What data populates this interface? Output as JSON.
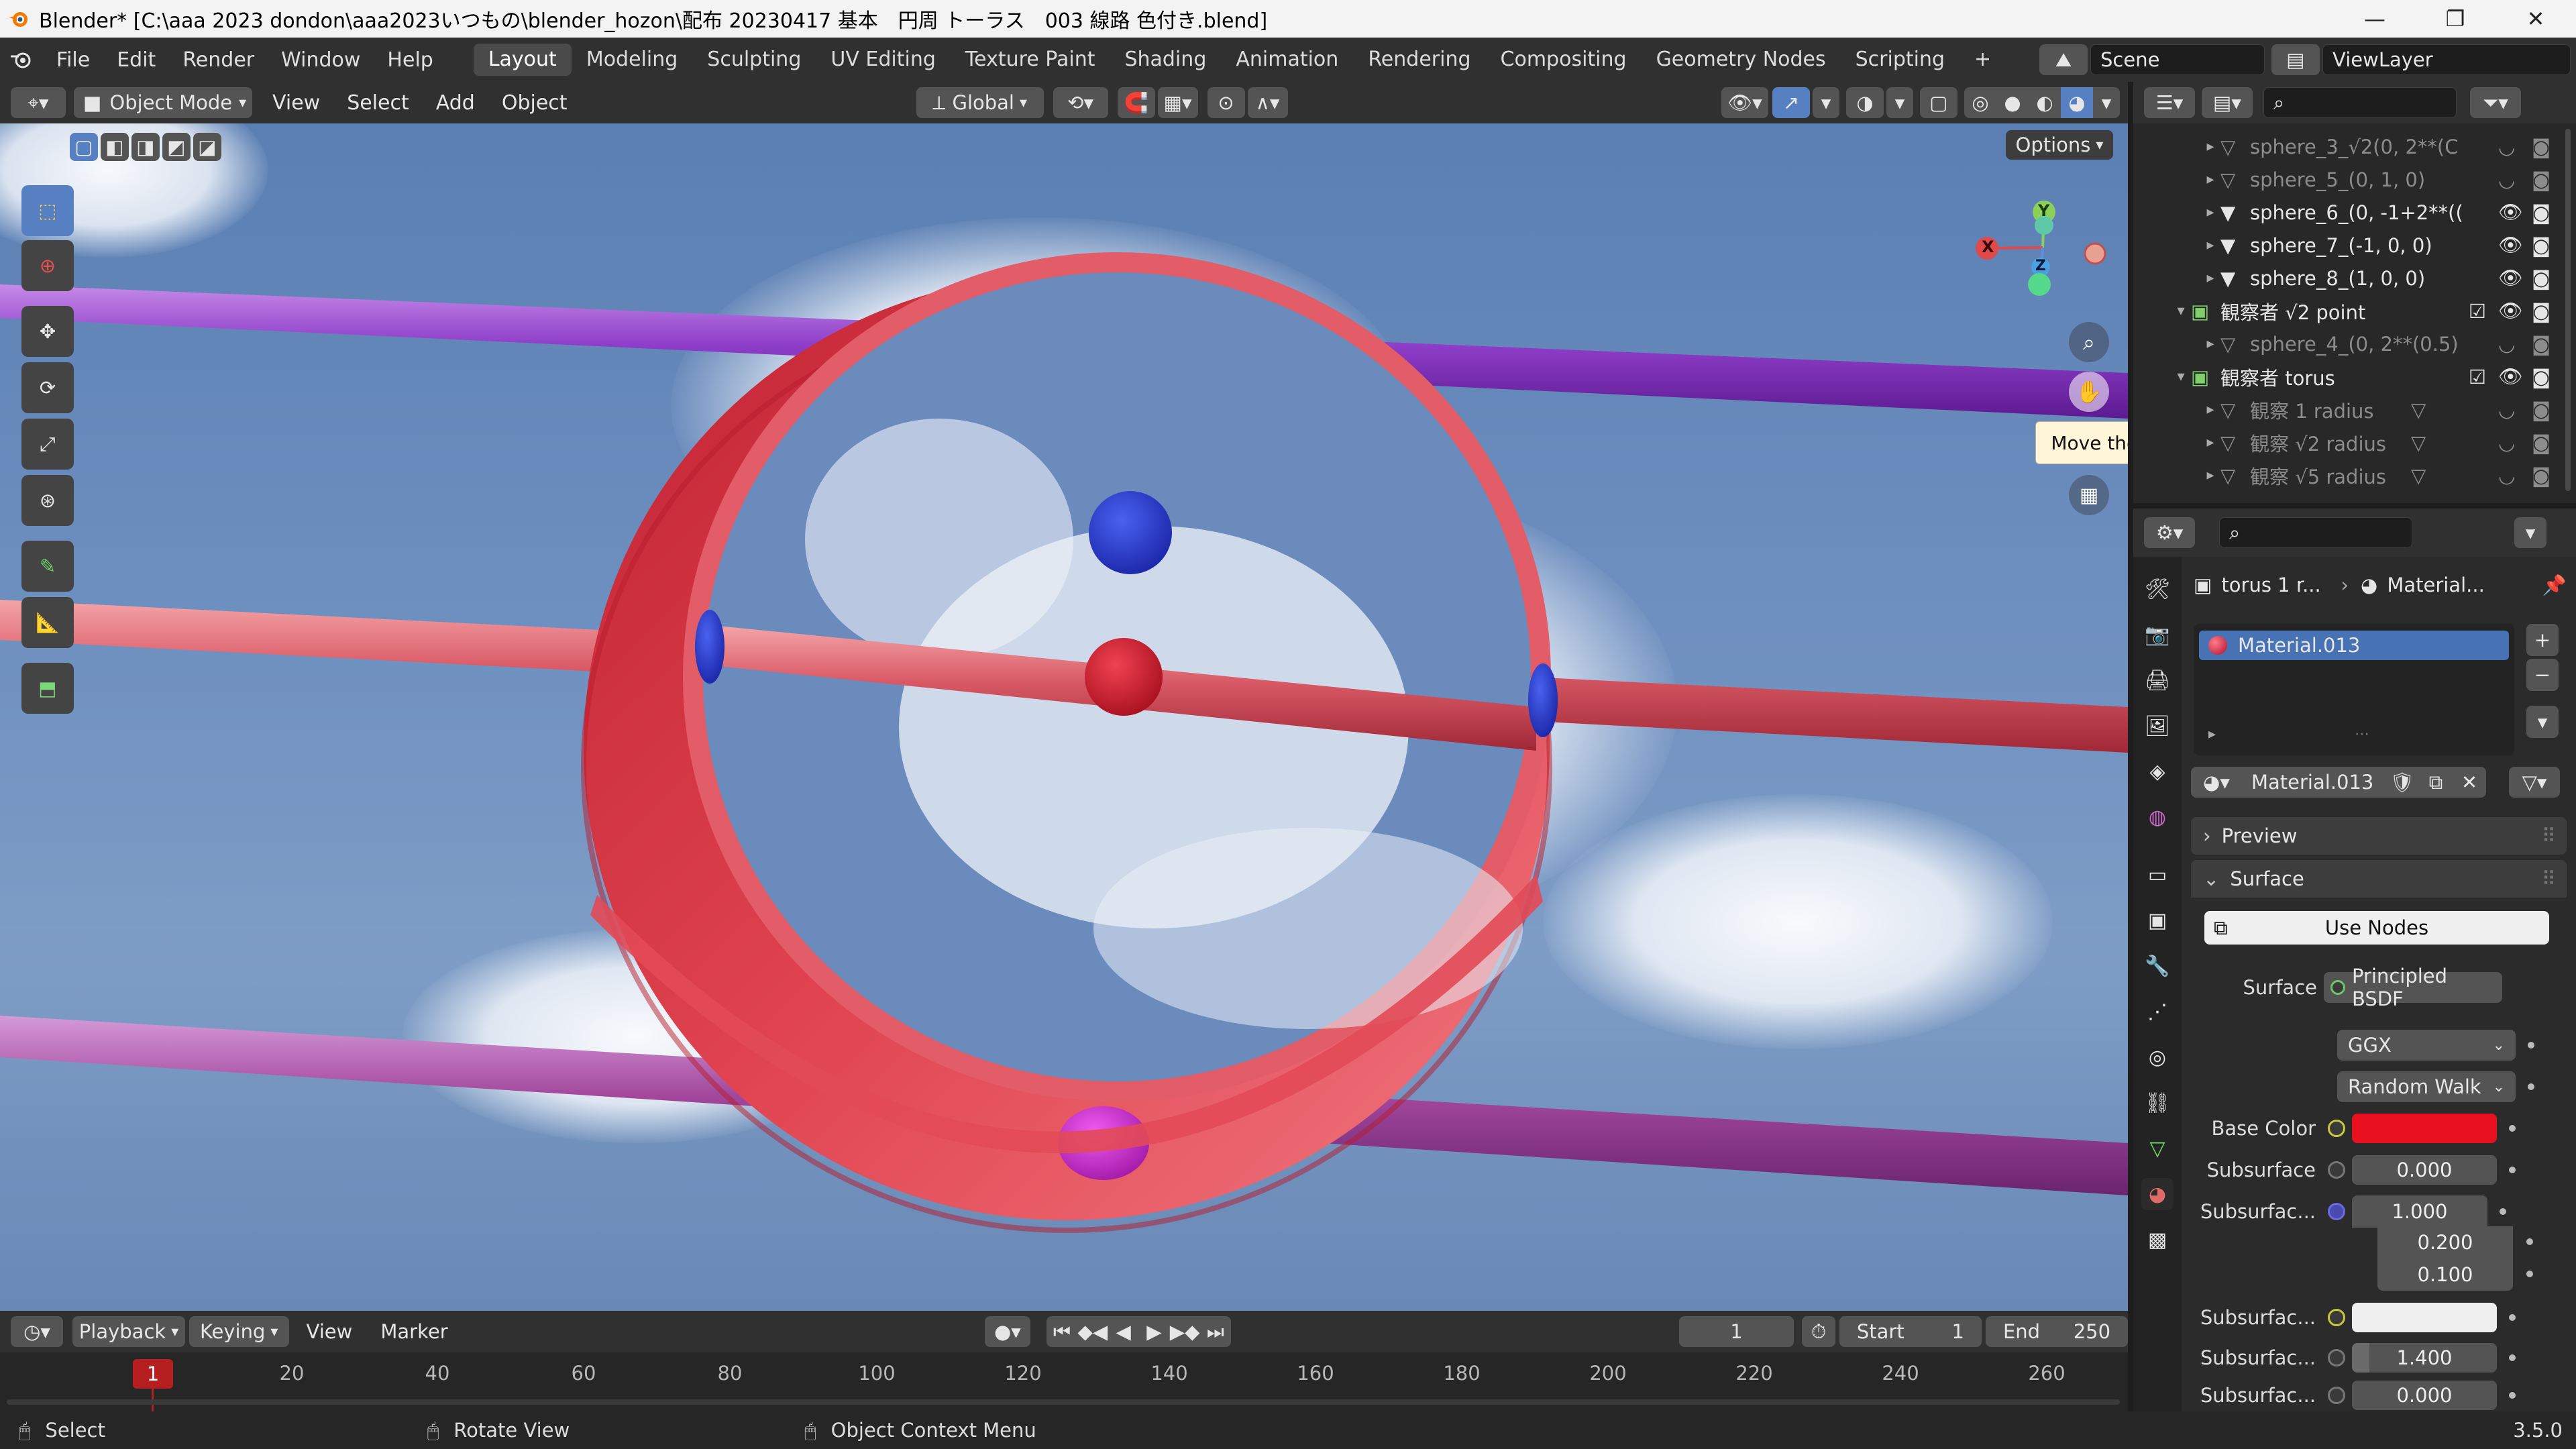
{
  "title": "Blender* [C:\\aaa 2023 dondon\\aaa2023いつもの\\blender_hozon\\配布 20230417 基本　円周 トーラス　003 線路 色付き.blend]",
  "window_buttons": [
    "—",
    "❐",
    "✕"
  ],
  "menu": [
    "File",
    "Edit",
    "Render",
    "Window",
    "Help"
  ],
  "workspaces": [
    "Layout",
    "Modeling",
    "Sculpting",
    "UV Editing",
    "Texture Paint",
    "Shading",
    "Animation",
    "Rendering",
    "Compositing",
    "Geometry Nodes",
    "Scripting"
  ],
  "add_workspace": "+",
  "scene": "Scene",
  "view_layer": "ViewLayer",
  "viewport_header": {
    "mode": "Object Mode",
    "menus": [
      "View",
      "Select",
      "Add",
      "Object"
    ],
    "transform": "Global"
  },
  "options_label": "Options",
  "gizmo": {
    "x": "X",
    "y": "Y",
    "z": "Z"
  },
  "tooltip": "Move the view",
  "outliner": {
    "rows": [
      {
        "label": "sphere_3_√2(0, 2**(C",
        "dim": true
      },
      {
        "label": "sphere_5_(0, 1, 0)",
        "dim": true
      },
      {
        "label": "sphere_6_(0, -1+2**((",
        "dim": false
      },
      {
        "label": "sphere_7_(-1, 0, 0)",
        "dim": false
      },
      {
        "label": "sphere_8_(1, 0, 0)",
        "dim": false
      },
      {
        "label": "観察者 √2 point",
        "dim": false,
        "collection": true
      },
      {
        "label": "sphere_4_(0, 2**(0.5)",
        "dim": true
      },
      {
        "label": "観察者 torus",
        "dim": false,
        "collection": true
      },
      {
        "label": "観察 1 radius",
        "dim": true
      },
      {
        "label": "観察 √2 radius",
        "dim": true
      },
      {
        "label": "観察 √5 radius",
        "dim": true
      }
    ]
  },
  "properties": {
    "breadcrumb_object": "torus 1 r...",
    "breadcrumb_material": "Material...",
    "slot": "Material.013",
    "material_name": "Material.013",
    "preview": "Preview",
    "surface_panel": "Surface",
    "use_nodes": "Use Nodes",
    "surface_label": "Surface",
    "surface_value": "Principled BSDF",
    "distribution": "GGX",
    "subsurface_method": "Random Walk",
    "base_color_label": "Base Color",
    "base_color": "#e8101e",
    "subsurface_label": "Subsurface",
    "subsurface_value": "0.000",
    "subsurface_radius_label": "Subsurfac...",
    "subsurface_radius": [
      "1.000",
      "0.200",
      "0.100"
    ],
    "subsurface_color_label": "Subsurfac...",
    "subsurface_ior_label": "Subsurfac...",
    "subsurface_ior": "1.400",
    "subsurface_aniso_label": "Subsurfac...",
    "subsurface_aniso": "0.000"
  },
  "timeline": {
    "menus": [
      "Playback",
      "Keying",
      "View",
      "Marker"
    ],
    "current_frame": "1",
    "start_label": "Start",
    "start": "1",
    "end_label": "End",
    "end": "250",
    "ruler": [
      "1",
      "20",
      "40",
      "60",
      "80",
      "100",
      "120",
      "140",
      "160",
      "180",
      "200",
      "220",
      "240",
      "260"
    ]
  },
  "status": {
    "select": "Select",
    "rotate": "Rotate View",
    "context": "Object Context Menu",
    "version": "3.5.0"
  }
}
